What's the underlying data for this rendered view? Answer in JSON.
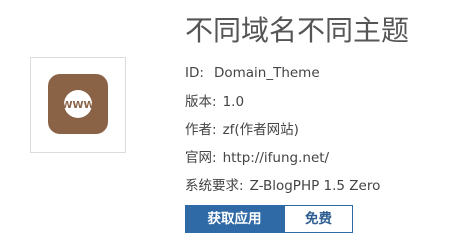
{
  "theme": {
    "title": "不同域名不同主题",
    "icon": "www-globe-icon",
    "icon_text": "WWW",
    "accent_color": "#8a6346"
  },
  "info": {
    "id_label": "ID:",
    "id_value": "Domain_Theme",
    "version_label": "版本:",
    "version_value": "1.0",
    "author_label": "作者:",
    "author_value": "zf(作者网站)",
    "site_label": "官网:",
    "site_value": "http://ifung.net/",
    "requirement_label": "系统要求:",
    "requirement_value": "Z-BlogPHP 1.5 Zero"
  },
  "actions": {
    "get_label": "获取应用",
    "price_label": "免费",
    "primary_color": "#2f69a6"
  }
}
